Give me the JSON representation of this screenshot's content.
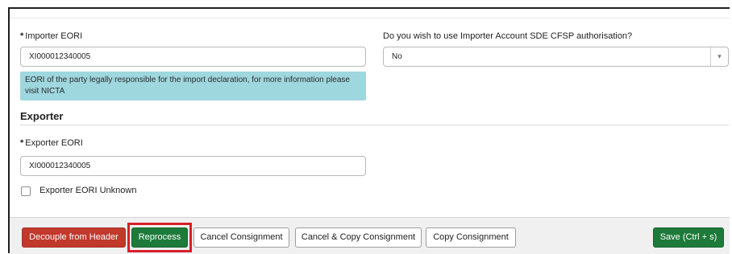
{
  "importer": {
    "eori_label": "Importer EORI",
    "eori_value": "XI000012340005",
    "info_text": "EORI of the party legally responsible for the import declaration, for more information please visit NICTA"
  },
  "authorisation": {
    "label": "Do you wish to use Importer Account SDE CFSP authorisation?",
    "value": "No",
    "arrow": "▾"
  },
  "exporter": {
    "section_title": "Exporter",
    "eori_label": "Exporter EORI",
    "eori_value": "XI000012340005",
    "unknown_label": "Exporter EORI Unknown"
  },
  "required_marker": "*",
  "footer": {
    "decouple_label": "Decouple from Header",
    "reprocess_label": "Reprocess",
    "cancel_consignment_label": "Cancel Consignment",
    "cancel_copy_label": "Cancel & Copy Consignment",
    "copy_label": "Copy Consignment",
    "save_label": "Save (Ctrl + s)"
  },
  "colors": {
    "red_button": "#c0392b",
    "green_button": "#1e7a3a",
    "info_background": "#9fd7df",
    "highlight_outline": "#d6202a"
  }
}
